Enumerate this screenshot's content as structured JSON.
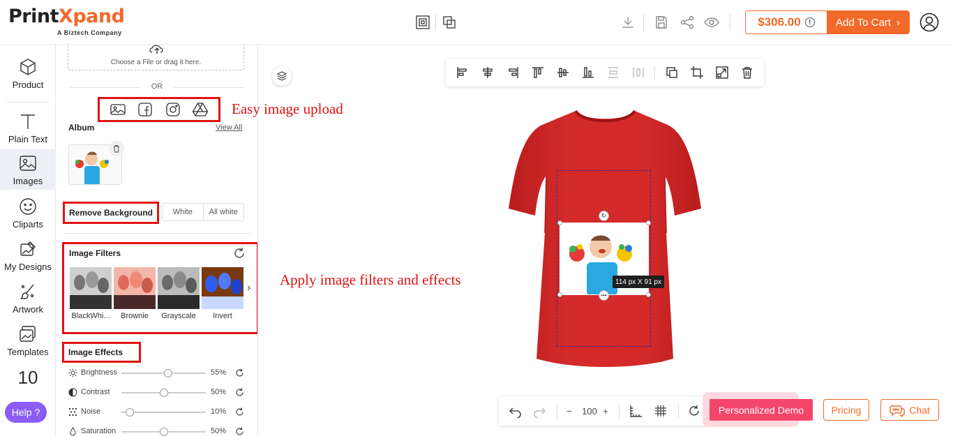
{
  "header": {
    "logo_text_a": "Print",
    "logo_text_b": "Xpand",
    "logo_tagline": "A Biztech Company",
    "price": "$306.00",
    "add_to_cart": "Add To Cart",
    "accent": "#f26a2a"
  },
  "nav": {
    "items": [
      {
        "label": "Product",
        "icon": "cube-icon"
      },
      {
        "label": "Plain Text",
        "icon": "text-icon"
      },
      {
        "label": "Images",
        "icon": "image-icon"
      },
      {
        "label": "Cliparts",
        "icon": "smiley-icon"
      },
      {
        "label": "My Designs",
        "icon": "designs-icon"
      },
      {
        "label": "Artwork",
        "icon": "brush-icon"
      },
      {
        "label": "Templates",
        "icon": "templates-icon"
      }
    ],
    "count": "10",
    "help": "Help ?"
  },
  "panel": {
    "drop_text": "Choose a File or drag it here.",
    "or": "OR",
    "album_title": "Album",
    "view_all": "View All",
    "remove_bg": "Remove Background",
    "bg_options": [
      "White",
      "All white"
    ],
    "filters_title": "Image Filters",
    "filters": [
      {
        "label": "BlackWhi...",
        "tone": "gray"
      },
      {
        "label": "Brownie",
        "tone": "rose"
      },
      {
        "label": "Grayscale",
        "tone": "gray"
      },
      {
        "label": "Invert",
        "tone": "blue"
      }
    ],
    "effects_title": "Image Effects",
    "effects": [
      {
        "label": "Brightness",
        "value": "55%",
        "level": 0.55
      },
      {
        "label": "Contrast",
        "value": "50%",
        "level": 0.5
      },
      {
        "label": "Noise",
        "value": "10%",
        "level": 0.1
      },
      {
        "label": "Saturation",
        "value": "50%",
        "level": 0.5
      }
    ]
  },
  "canvas": {
    "size_tag": "114 px X 91 px",
    "annotation_upload": "Easy image upload",
    "annotation_filters": "Apply image filters and effects",
    "shirt_color": "#d42a2a",
    "zoom": "100",
    "demo_btn": "Personalized Demo",
    "pricing_btn": "Pricing",
    "chat_btn": "Chat"
  }
}
